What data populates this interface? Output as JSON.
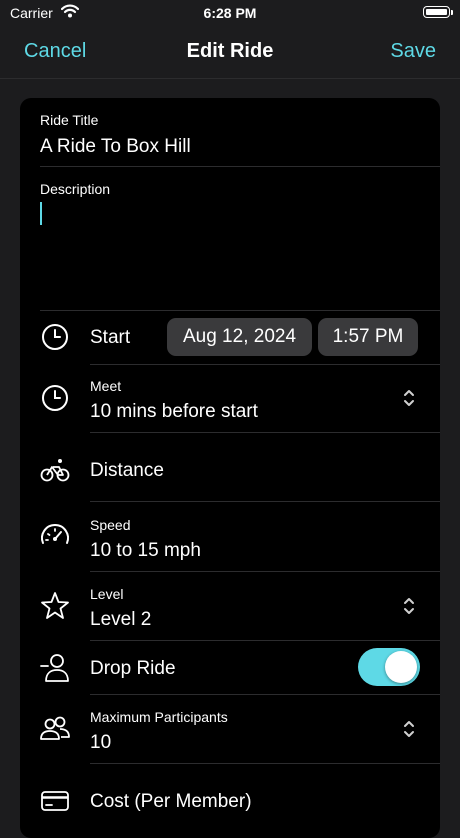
{
  "status_bar": {
    "carrier": "Carrier",
    "time": "6:28 PM"
  },
  "nav": {
    "cancel": "Cancel",
    "title": "Edit Ride",
    "save": "Save"
  },
  "form": {
    "ride_title": {
      "label": "Ride Title",
      "value": "A Ride To Box Hill"
    },
    "description": {
      "label": "Description",
      "value": ""
    },
    "start": {
      "label": "Start",
      "date": "Aug 12, 2024",
      "time": "1:57 PM",
      "icon": "clock-icon"
    },
    "meet": {
      "label": "Meet",
      "value": "10 mins before start",
      "icon": "clock-icon"
    },
    "distance": {
      "label": "Distance",
      "icon": "bicycle-icon"
    },
    "speed": {
      "label": "Speed",
      "value": "10 to 15 mph",
      "icon": "speedometer-icon"
    },
    "level": {
      "label": "Level",
      "value": "Level 2",
      "icon": "star-icon"
    },
    "drop_ride": {
      "label": "Drop Ride",
      "on": true,
      "icon": "person-minus-icon"
    },
    "max_participants": {
      "label": "Maximum Participants",
      "value": "10",
      "icon": "people-icon"
    },
    "cost": {
      "label": "Cost (Per Member)",
      "icon": "credit-card-icon"
    }
  },
  "colors": {
    "accent": "#5ed9e6",
    "background": "#1c1c1e",
    "card": "#000000",
    "pill": "#3a3a3c"
  }
}
